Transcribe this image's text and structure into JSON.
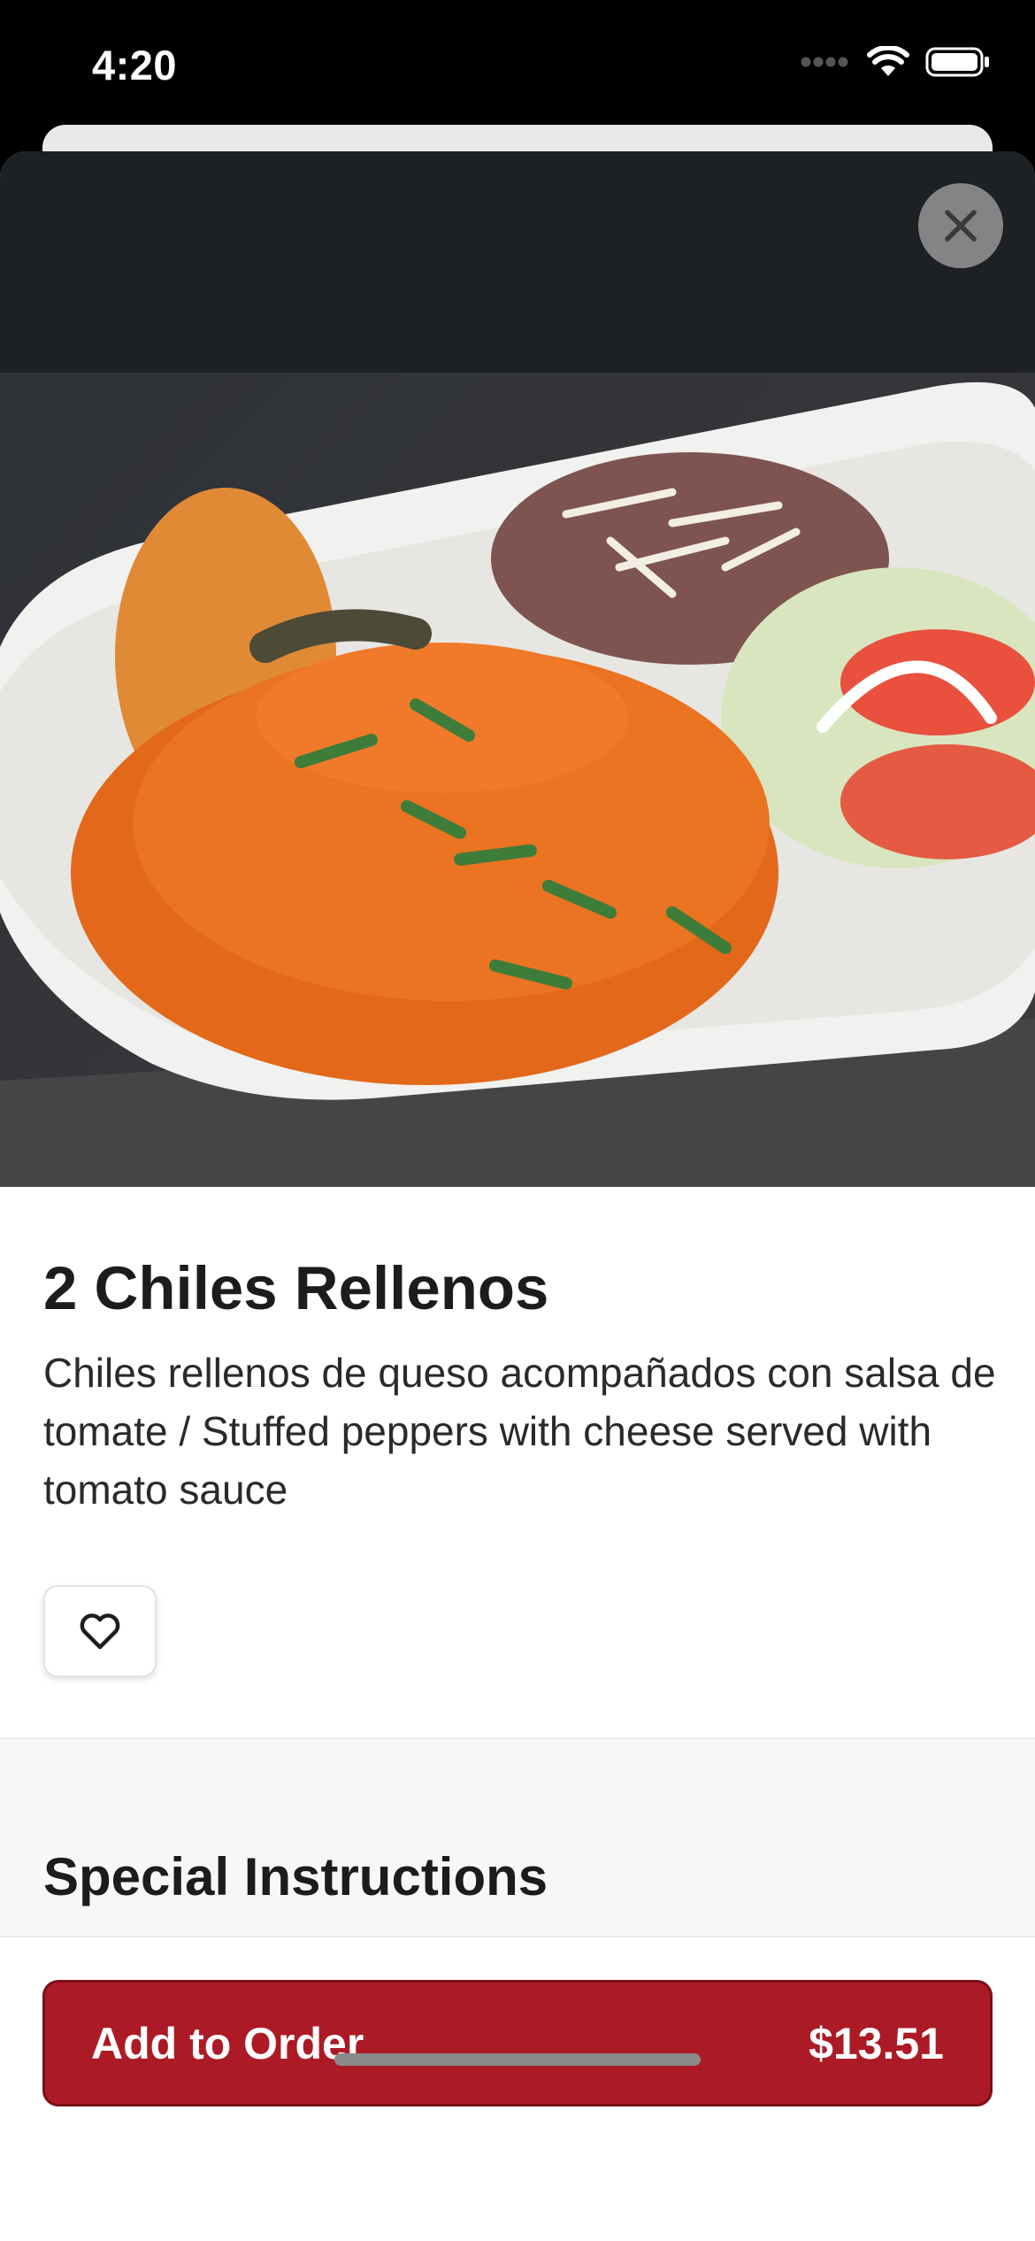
{
  "status_bar": {
    "time": "4:20"
  },
  "item": {
    "title": "2 Chiles Rellenos",
    "description": "Chiles rellenos de queso acompañados con salsa de tomate / Stuffed peppers with cheese served with tomato sauce"
  },
  "sections": {
    "special_instructions": "Special Instructions"
  },
  "footer": {
    "add_label": "Add to Order",
    "price": "$13.51"
  },
  "colors": {
    "accent": "#ac1a25",
    "sauce": "#e3681a",
    "plate": "#f1f1ef"
  }
}
